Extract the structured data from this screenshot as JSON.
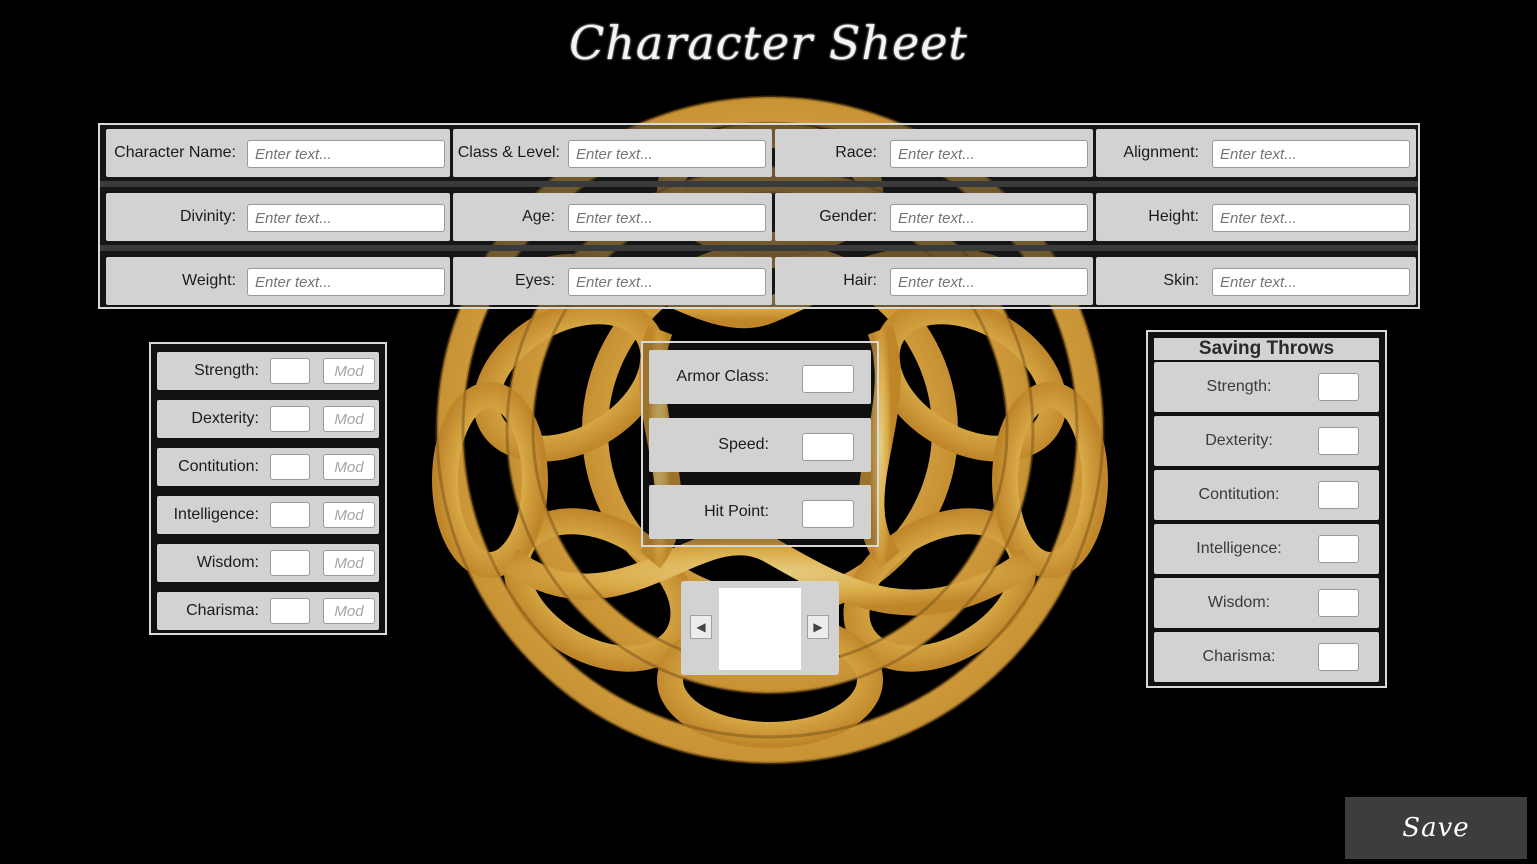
{
  "title": "Character Sheet",
  "placeholder": "Enter text...",
  "info_rows": [
    [
      {
        "label": "Character Name:",
        "name": "character-name"
      },
      {
        "label": "Class & Level:",
        "name": "class-level"
      },
      {
        "label": "Race:",
        "name": "race"
      },
      {
        "label": "Alignment:",
        "name": "alignment"
      }
    ],
    [
      {
        "label": "Divinity:",
        "name": "divinity"
      },
      {
        "label": "Age:",
        "name": "age"
      },
      {
        "label": "Gender:",
        "name": "gender"
      },
      {
        "label": "Height:",
        "name": "height"
      }
    ],
    [
      {
        "label": "Weight:",
        "name": "weight"
      },
      {
        "label": "Eyes:",
        "name": "eyes"
      },
      {
        "label": "Hair:",
        "name": "hair"
      },
      {
        "label": "Skin:",
        "name": "skin"
      }
    ]
  ],
  "mod_placeholder": "Mod",
  "abilities": [
    "Strength:",
    "Dexterity:",
    "Contitution:",
    "Intelligence:",
    "Wisdom:",
    "Charisma:"
  ],
  "combat": [
    "Armor Class:",
    "Speed:",
    "Hit Point:"
  ],
  "portrait": {
    "prev_icon": "left-arrow-icon",
    "next_icon": "right-arrow-icon",
    "prev": "◀",
    "next": "▶"
  },
  "saving_throws": {
    "header": "Saving Throws",
    "items": [
      "Strength:",
      "Dexterity:",
      "Contitution:",
      "Intelligence:",
      "Wisdom:",
      "Charisma:"
    ]
  },
  "save_button": "Save",
  "colors": {
    "background": "#000000",
    "panel": "#d2d2d2",
    "knot_gold": "#e8b84a",
    "save_button": "#3d3d3d"
  }
}
